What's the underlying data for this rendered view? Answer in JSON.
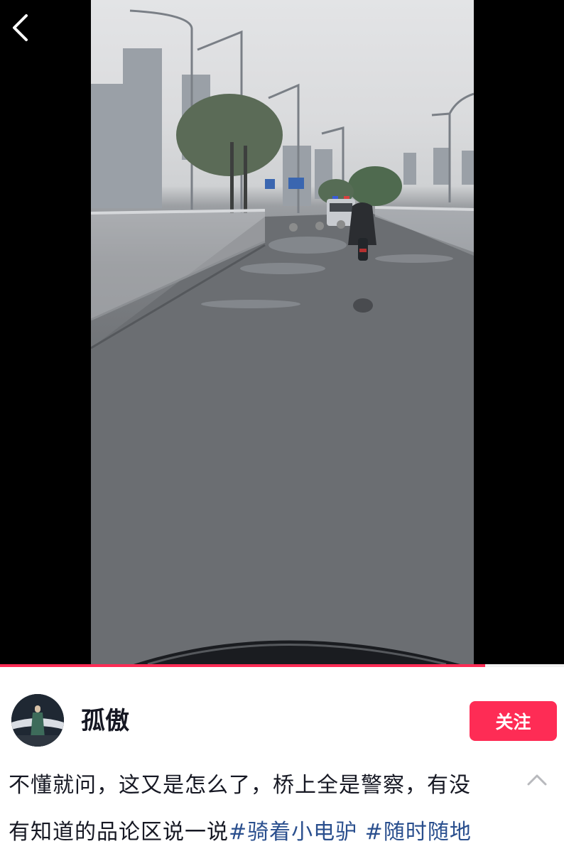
{
  "video": {
    "back_icon": "chevron-left-icon",
    "progress": 0.86
  },
  "author": {
    "name": "孤傲",
    "follow_label": "关注"
  },
  "caption": {
    "line1": "不懂就问，这又是怎么了，桥上全是警察，有没",
    "line2_text": "有知道的品论区说一说",
    "hashtags": [
      "#骑着小电驴",
      " #随时随地"
    ],
    "collapse_icon": "chevron-up-icon"
  },
  "colors": {
    "accent": "#fe2c55",
    "hashtag": "#2a4f8e",
    "text": "#161823"
  }
}
